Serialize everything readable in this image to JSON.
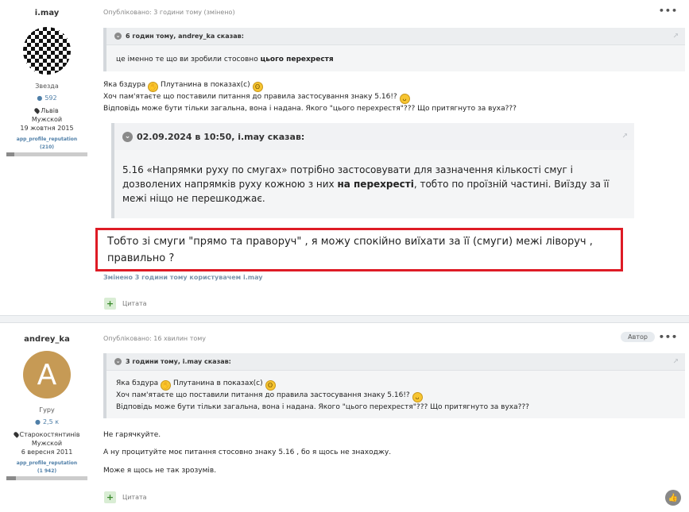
{
  "post1": {
    "author": {
      "name": "i.may",
      "rank": "Звезда",
      "reputation": "592",
      "location": "Львів",
      "gender": "Мужской",
      "joined": "19 жовтня 2015",
      "app_rep_label": "app_profile_reputation",
      "app_rep_value": "(210)",
      "rep_bar_fraction": 0.1
    },
    "meta": "Опубліковано: 3 години тому (змінено)",
    "quote1": {
      "header": "6 годин тому, andrey_ka сказав:",
      "text_before": "це іменно те що ви зробили стосовно ",
      "text_bold": "цього перехрестя"
    },
    "body_line1_a": "Яка бздура",
    "body_line1_b": "Плутанина в показах(с)",
    "body_line2": "Хоч пам'ятаєте що поставили питання до правила застосування знаку 5.16!?",
    "body_line3": "Відповідь може бути тільки загальна, вона і надана. Якого \"цього перехрестя\"??? Що притягнуто за вуха???",
    "quote2": {
      "header": "02.09.2024 в 10:50, i.may сказав:",
      "text_before": "5.16 «Напрямки руху по смугах» потрібно застосовувати для зазначення кількості смуг і дозволених напрямків руху кожною з них ",
      "text_bold": "на перехресті",
      "text_after": ", тобто по проїзній частині. Виїзду за її межі ніщо не перешкоджає."
    },
    "highlight": "Тобто зі смуги \"прямо та праворуч\" , я можу спокійно виїхати за її (смуги) межі ліворуч , правильно ?",
    "edited": "Змінено 3 години тому користувачем i.may",
    "quote_button": "Цитата"
  },
  "post2": {
    "author": {
      "name": "andrey_ka",
      "avatar_letter": "A",
      "rank": "Гуру",
      "reputation": "2,5 к",
      "location": "Старокостянтинів",
      "gender": "Мужской",
      "joined": "6 вересня 2011",
      "app_rep_label": "app_profile_reputation",
      "app_rep_value": "(1 942)",
      "rep_bar_fraction": 0.12
    },
    "meta": "Опубліковано: 16 хвилин тому",
    "badge": "Автор",
    "quote": {
      "header": "3 години тому, i.may сказав:",
      "line1_a": "Яка бздура",
      "line1_b": "Плутанина в показах(с)",
      "line2": "Хоч пам'ятаєте що поставили питання до правила застосування знаку 5.16!?",
      "line3": "Відповідь може бути тільки загальна, вона і надана. Якого \"цього перехрестя\"??? Що притягнуто за вуха???"
    },
    "para1": "Не гарячкуйте.",
    "para2": "А ну процитуйте моє питання стосовно знаку 5.16 , бо я щось не знаходжу.",
    "para3": "Може я щось не так зрозумів.",
    "quote_button": "Цитата"
  },
  "colors": {
    "highlight_border": "#de1b25",
    "link": "#4f7fa8",
    "avatar_bg": "#c69a55"
  }
}
